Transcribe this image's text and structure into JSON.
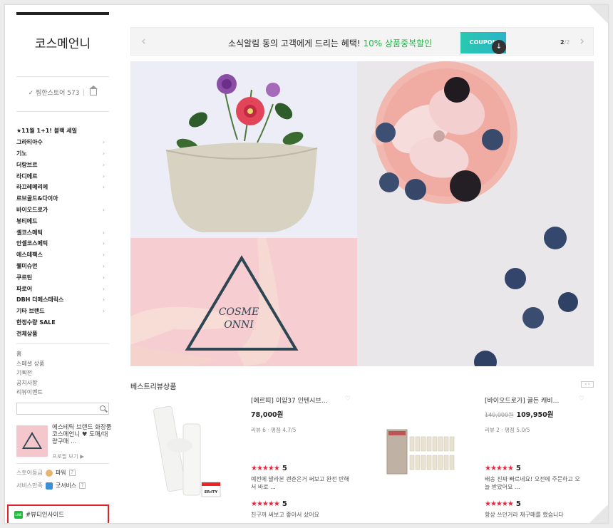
{
  "sidebar": {
    "store_name": "코스메언니",
    "follow_label": "✓ 찜한스토어 573",
    "categories": [
      {
        "label": "★11월 1+1! 블랙 세일",
        "arrow": false
      },
      {
        "label": "그라티아수",
        "arrow": true
      },
      {
        "label": "기노",
        "arrow": true
      },
      {
        "label": "더랑브르",
        "arrow": true
      },
      {
        "label": "라디메르",
        "arrow": true
      },
      {
        "label": "라끄레메리에",
        "arrow": true
      },
      {
        "label": "르브골드&다이아",
        "arrow": false
      },
      {
        "label": "바이오드로가",
        "arrow": true
      },
      {
        "label": "뷰티메드",
        "arrow": false
      },
      {
        "label": "셀코스메틱",
        "arrow": true
      },
      {
        "label": "안셀코스메틱",
        "arrow": true
      },
      {
        "label": "에스테팩스",
        "arrow": true
      },
      {
        "label": "웰미슈먼",
        "arrow": true
      },
      {
        "label": "쿠르틴",
        "arrow": true
      },
      {
        "label": "파로어",
        "arrow": true
      },
      {
        "label": "DBH 더메스테릭스",
        "arrow": true
      },
      {
        "label": "기타 브랜드",
        "arrow": true
      },
      {
        "label": "한정수량 SALE",
        "arrow": false
      },
      {
        "label": "전체상품",
        "arrow": false
      }
    ],
    "arrow_glyph": "›",
    "links": [
      "홈",
      "스페셜 상품",
      "기획전",
      "공지사항",
      "리뷰이벤트"
    ],
    "promo": {
      "text": "에스테틱 브랜드 화장품 코스메언니 ♥ 도매/대량구매 ...",
      "profile_link": "프로필 보기 ▶"
    },
    "store_grade_label": "스토어등급",
    "store_grade_value": "파워",
    "service_label": "서비스만족",
    "service_value": "굿서비스",
    "help_glyph": "?",
    "line_label": "#뷰티인사이드",
    "line_icon_text": "LINE"
  },
  "notice": {
    "prev": "‹",
    "next": "›",
    "message_main": "소식알림 동의 고객에게 드리는 혜택!",
    "message_highlight": "10% 상품중복할인",
    "coupon_label": "COUPON",
    "download_glyph": "↓",
    "page_current": "2",
    "page_total": "/2"
  },
  "hero": {
    "logo_line1": "COSME",
    "logo_line2": "ONNI"
  },
  "best": {
    "title": "베스트리뷰상품",
    "slider_glyph": "‹ ›",
    "products": [
      {
        "name": "[에르띠] 이얍37 인텐시브…",
        "price": "78,000원",
        "original_price": "",
        "meta": "리뷰 6 · 평점 4.7/5",
        "heart": "♡",
        "reviews": [
          {
            "stars": "★★★★★",
            "score": "5",
            "text": "예전에 발라본 괜춘은거 써보고 완전 반해서 바로 ..."
          },
          {
            "stars": "★★★★★",
            "score": "5",
            "text": "친구꺼 써보고 좋아서 샀어요"
          }
        ]
      },
      {
        "name": "[바이오드로가] 골든 캐비…",
        "price": "109,950원",
        "original_price": "140,000원",
        "meta": "리뷰 2 · 평점 5.0/5",
        "heart": "♡",
        "reviews": [
          {
            "stars": "★★★★★",
            "score": "5",
            "text": "배송 진짜 빠르네요! 오전에 주문하고 오늘 받았어요 ..."
          },
          {
            "stars": "★★★★★",
            "score": "5",
            "text": "항상 쓰던거라 재구매를 했습니다"
          }
        ]
      }
    ],
    "product1_brand": "ER:ITY"
  },
  "colors": {
    "accent_green": "#2ab24b",
    "coupon": "#29c8b0",
    "star_red": "#e8283b",
    "highlight_box": "#e0202a"
  }
}
